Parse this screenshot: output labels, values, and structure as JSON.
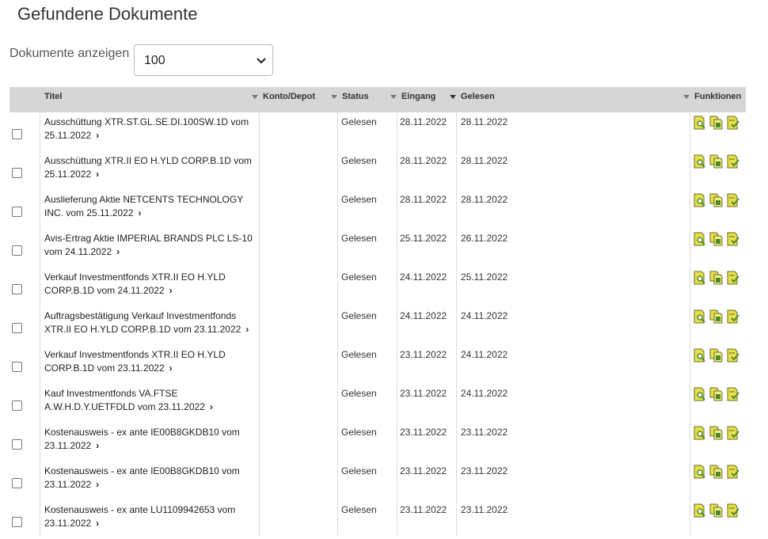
{
  "page": {
    "title": "Gefundene Dokumente"
  },
  "filter": {
    "label": "Dokumente anzeigen",
    "selected": "100"
  },
  "table": {
    "columns": {
      "title": "Titel",
      "account": "Konto/Depot",
      "status": "Status",
      "received": "Eingang",
      "read": "Gelesen",
      "functions": "Funktionen"
    },
    "rows": [
      {
        "title_line1": "Ausschüttung XTR.ST.GL.SE.DI.100SW.1D vom",
        "title_line2": "25.11.2022",
        "status": "Gelesen",
        "received": "28.11.2022",
        "read": "28.11.2022"
      },
      {
        "title_line1": "Ausschüttung XTR.II EO H.YLD CORP.B.1D vom",
        "title_line2": "25.11.2022",
        "status": "Gelesen",
        "received": "28.11.2022",
        "read": "28.11.2022"
      },
      {
        "title_line1": "Auslieferung Aktie NETCENTS TECHNOLOGY",
        "title_line2": "INC. vom 25.11.2022",
        "status": "Gelesen",
        "received": "28.11.2022",
        "read": "28.11.2022"
      },
      {
        "title_line1": "Avis-Ertrag Aktie IMPERIAL BRANDS PLC LS-10",
        "title_line2": "vom 24.11.2022",
        "status": "Gelesen",
        "received": "25.11.2022",
        "read": "26.11.2022"
      },
      {
        "title_line1": "Verkauf Investmentfonds XTR.II EO H.YLD",
        "title_line2": "CORP.B.1D vom 24.11.2022",
        "status": "Gelesen",
        "received": "24.11.2022",
        "read": "25.11.2022"
      },
      {
        "title_line1": "Auftragsbestätigung Verkauf Investmentfonds",
        "title_line2": "XTR.II EO H.YLD CORP.B.1D vom 23.11.2022",
        "status": "Gelesen",
        "received": "24.11.2022",
        "read": "24.11.2022"
      },
      {
        "title_line1": "Verkauf Investmentfonds XTR.II EO H.YLD",
        "title_line2": "CORP.B.1D vom 23.11.2022",
        "status": "Gelesen",
        "received": "23.11.2022",
        "read": "24.11.2022"
      },
      {
        "title_line1": "Kauf Investmentfonds VA.FTSE",
        "title_line2": "A.W.H.D.Y.UETFDLD vom 23.11.2022",
        "status": "Gelesen",
        "received": "23.11.2022",
        "read": "24.11.2022"
      },
      {
        "title_line1": "Kostenausweis - ex ante IE00B8GKDB10 vom",
        "title_line2": "23.11.2022",
        "status": "Gelesen",
        "received": "23.11.2022",
        "read": "23.11.2022"
      },
      {
        "title_line1": "Kostenausweis - ex ante IE00B8GKDB10 vom",
        "title_line2": "23.11.2022",
        "status": "Gelesen",
        "received": "23.11.2022",
        "read": "23.11.2022"
      },
      {
        "title_line1": "Kostenausweis - ex ante LU1109942653 vom",
        "title_line2": "23.11.2022",
        "status": "Gelesen",
        "received": "23.11.2022",
        "read": "23.11.2022"
      }
    ],
    "row_icons": [
      "view-document-icon",
      "copy-document-icon",
      "mark-read-icon"
    ]
  },
  "colors": {
    "header_bg": "#d6d6d6",
    "icon_yellow": "#e6e04a",
    "icon_green": "#4b8a2e"
  }
}
